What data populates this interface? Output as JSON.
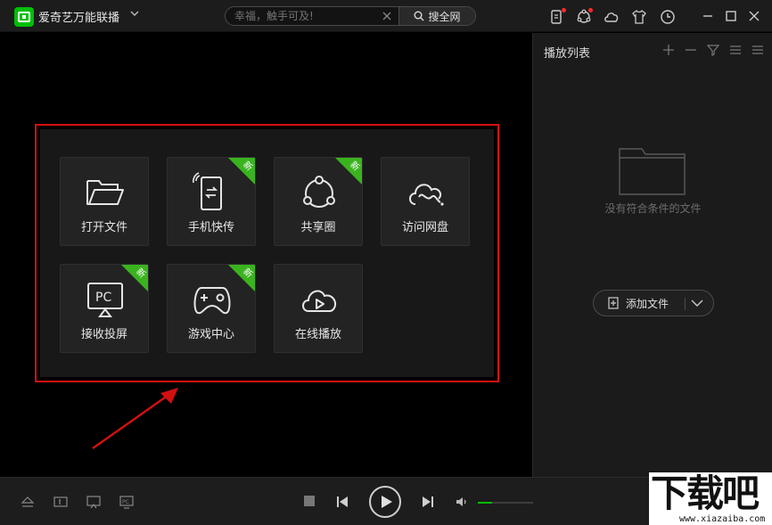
{
  "app": {
    "title": "爱奇艺万能联播",
    "accent": "#00be06"
  },
  "search": {
    "placeholder": "幸福，触手可及!",
    "button_label": "搜全网"
  },
  "toolbar_icons": [
    "phone-notify-icon",
    "share-circle-icon",
    "cloud-icon",
    "skin-shirt-icon",
    "history-clock-icon"
  ],
  "window_controls": [
    "minimize-icon",
    "maximize-icon",
    "close-icon"
  ],
  "tiles": [
    {
      "label": "打开文件",
      "icon": "folder-icon",
      "new": false
    },
    {
      "label": "手机快传",
      "icon": "phone-transfer-icon",
      "new": true
    },
    {
      "label": "共享圈",
      "icon": "share-circle-icon",
      "new": true
    },
    {
      "label": "访问网盘",
      "icon": "cloud-drive-icon",
      "new": false
    },
    {
      "label": "接收投屏",
      "icon": "pc-cast-icon",
      "new": true
    },
    {
      "label": "游戏中心",
      "icon": "gamepad-icon",
      "new": true
    },
    {
      "label": "在线播放",
      "icon": "cloud-play-icon",
      "new": false
    }
  ],
  "badge_label": "新",
  "highlight_color": "#d31010",
  "playlist": {
    "title": "播放列表",
    "empty_text": "没有符合条件的文件",
    "add_button_label": "添加文件"
  },
  "bottom": {
    "left_icons": [
      "eject-icon",
      "subtitle-icon",
      "screen-cast-icon",
      "pc-icon"
    ],
    "volume": 0.25
  },
  "watermark": {
    "big": "下载吧",
    "small": "www.xiazaiba.com"
  }
}
